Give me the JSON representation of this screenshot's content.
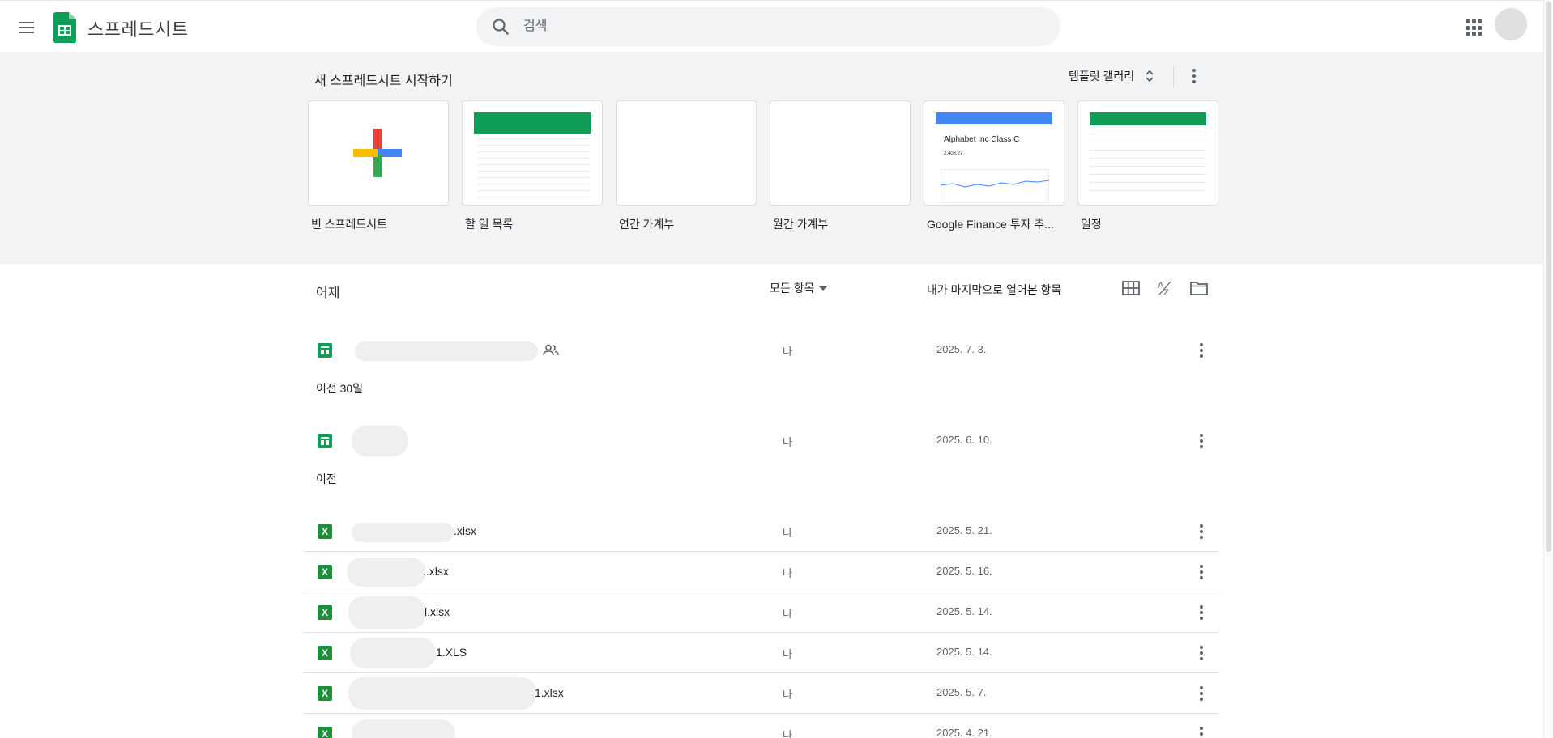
{
  "header": {
    "app_title": "스프레드시트",
    "search_placeholder": "검색"
  },
  "templates": {
    "title": "새 스프레드시트 시작하기",
    "gallery_label": "템플릿 갤러리",
    "items": [
      {
        "name": "빈 스프레드시트"
      },
      {
        "name": "할 일 목록"
      },
      {
        "name": "연간 가계부"
      },
      {
        "name": "월간 가계부"
      },
      {
        "name": "Google Finance 투자 추...",
        "preview_title": "Alphabet Inc Class C",
        "preview_value": "2,408.27"
      },
      {
        "name": "일정"
      }
    ]
  },
  "list": {
    "owner_filter": "모든 항목",
    "sort_label": "내가 마지막으로 열어본 항목",
    "sections": [
      {
        "label": "어제"
      },
      {
        "label": "이전 30일"
      },
      {
        "label": "이전"
      }
    ],
    "rows": [
      {
        "name_suffix": "",
        "type": "sheets",
        "owner": "나",
        "date": "2025. 7. 3.",
        "shared": true
      },
      {
        "name_suffix": "",
        "type": "sheets",
        "owner": "나",
        "date": "2025. 6. 10."
      },
      {
        "name_suffix": ".xlsx",
        "type": "excel",
        "owner": "나",
        "date": "2025. 5. 21."
      },
      {
        "name_suffix": "..xlsx",
        "type": "excel",
        "owner": "나",
        "date": "2025. 5. 16."
      },
      {
        "name_suffix": "l.xlsx",
        "type": "excel",
        "owner": "나",
        "date": "2025. 5. 14."
      },
      {
        "name_suffix": "1.XLS",
        "type": "excel",
        "owner": "나",
        "date": "2025. 5. 14."
      },
      {
        "name_suffix": "1.xlsx",
        "type": "excel",
        "owner": "나",
        "date": "2025. 5. 7."
      },
      {
        "name_suffix": "",
        "type": "excel",
        "owner": "나",
        "date": "2025. 4. 21."
      }
    ]
  },
  "colors": {
    "sheets_green": "#0f9d58",
    "band_bg": "#f1f3f4",
    "plus_red": "#ea4335",
    "plus_blue": "#4285f4",
    "plus_yellow": "#fbbc04",
    "plus_green": "#34a853"
  }
}
